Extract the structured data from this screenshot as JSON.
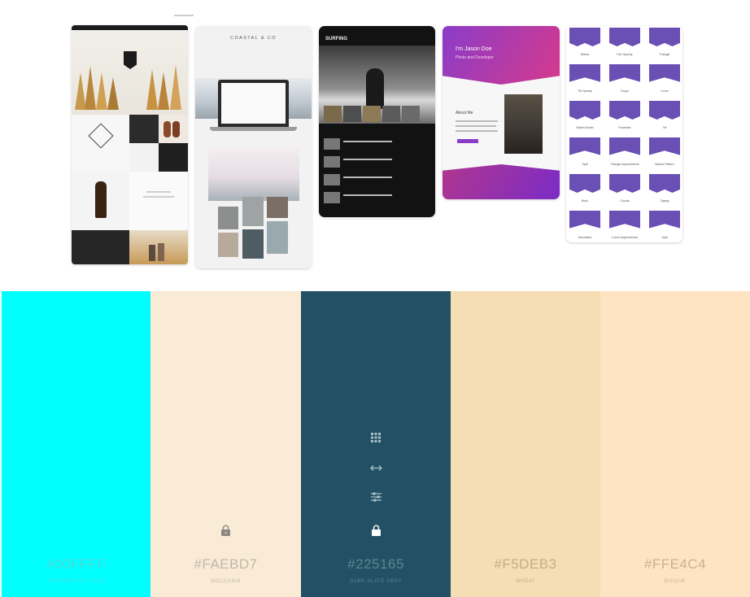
{
  "thumbnails": {
    "coastal_title": "COASTAL & CO",
    "surfing_logo": "SURFING",
    "jason_title": "I'm Jason Doe",
    "jason_subtitle": "Photo and Developer",
    "about_heading": "About Me",
    "shape_labels": [
      "Waves",
      "Fan Opacity",
      "Triangle",
      "Tilt Opacity",
      "Drops",
      "Curve",
      "Waves Brush",
      "Pyramids",
      "Tilt",
      "Split",
      "Triangle Asymmetrical",
      "Waves Pattern",
      "Book",
      "Clouds",
      "Zigzag",
      "Mountains",
      "Curve Asymmetrical",
      "Split"
    ]
  },
  "palette": {
    "colors": [
      {
        "hex": "#00FFFF",
        "name": "SPARROW SKY BLUE",
        "bg": "#00ffff",
        "text_color": "#4fd8d8"
      },
      {
        "hex": "#FAEBD7",
        "name": "MOCCASIN",
        "bg": "#faebd7",
        "text_color": "#c2b6a6"
      },
      {
        "hex": "#225165",
        "name": "DARK SLATE GRAY",
        "bg": "#225165",
        "text_color": "#5d8393"
      },
      {
        "hex": "#F5DEB3",
        "name": "WHEAT",
        "bg": "#f5deb3",
        "text_color": "#c5ad85"
      },
      {
        "hex": "#FFE4C4",
        "name": "BISQUE",
        "bg": "#ffe4c4",
        "text_color": "#c8b190"
      }
    ],
    "tool_icons": [
      "grid-icon",
      "swap-arrows-icon",
      "sliders-icon",
      "lock-icon"
    ],
    "lock_icons": [
      "lock-icon"
    ]
  }
}
